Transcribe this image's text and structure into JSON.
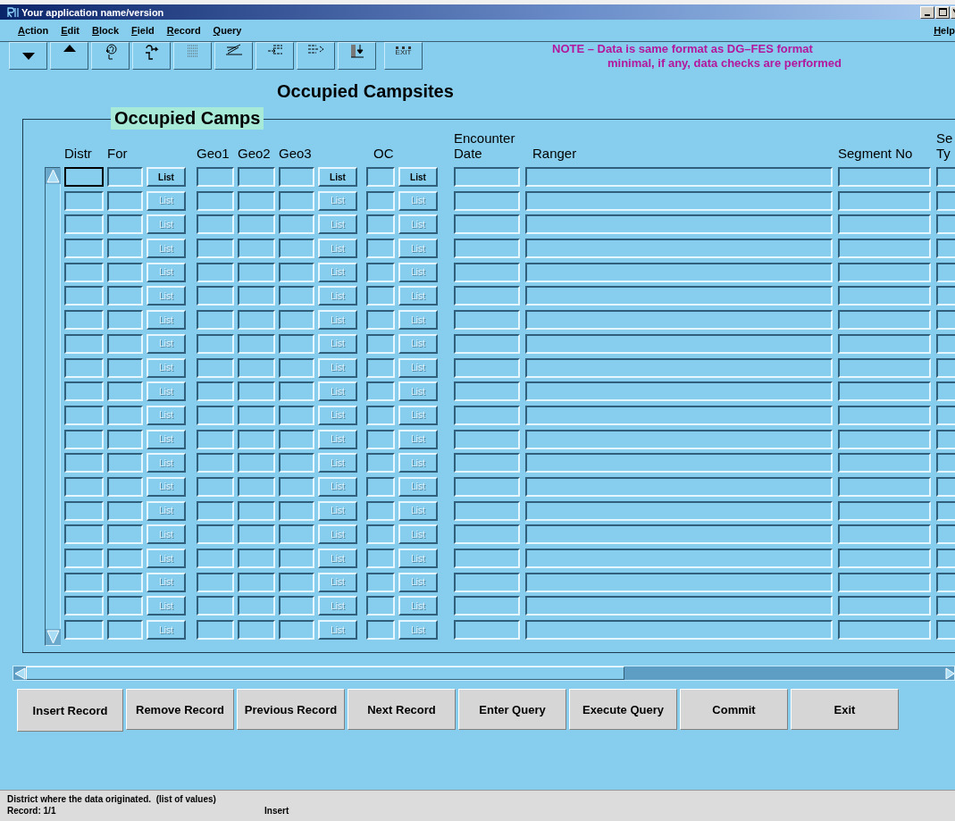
{
  "window": {
    "title": "Your application name/version"
  },
  "menu": {
    "items": [
      "Action",
      "Edit",
      "Block",
      "Field",
      "Record",
      "Query"
    ],
    "help": "Help"
  },
  "toolbar": {
    "buttons": [
      {
        "kind": "down"
      },
      {
        "kind": "up"
      },
      {
        "kind": "query"
      },
      {
        "kind": "execute"
      },
      {
        "kind": "list"
      },
      {
        "kind": "edit"
      },
      {
        "kind": "insert"
      },
      {
        "kind": "next"
      },
      {
        "kind": "save"
      },
      {
        "kind": "exit",
        "label": "EXIT"
      }
    ]
  },
  "note": [
    "NOTE – Data is same format as DG–FES format",
    "minimal, if any, data checks are performed"
  ],
  "heading": "Occupied Campsites",
  "frame": {
    "title": "Occupied Camps"
  },
  "table": {
    "columns": [
      "Distr",
      "For",
      "Geo1",
      "Geo2",
      "Geo3",
      "OC",
      "Encounter Date",
      "Ranger",
      "Segment No",
      "Se Ty"
    ],
    "rows": [
      {
        "focused": true,
        "disabled": false,
        "lists": [
          "List",
          "List",
          "List"
        ]
      },
      {
        "focused": false,
        "disabled": true,
        "lists": [
          "List",
          "List",
          "List"
        ]
      },
      {
        "focused": false,
        "disabled": true,
        "lists": [
          "List",
          "List",
          "List"
        ]
      },
      {
        "focused": false,
        "disabled": true,
        "lists": [
          "List",
          "List",
          "List"
        ]
      },
      {
        "focused": false,
        "disabled": true,
        "lists": [
          "List",
          "List",
          "List"
        ]
      },
      {
        "focused": false,
        "disabled": true,
        "lists": [
          "List",
          "List",
          "List"
        ]
      },
      {
        "focused": false,
        "disabled": true,
        "lists": [
          "List",
          "List",
          "List"
        ]
      },
      {
        "focused": false,
        "disabled": true,
        "lists": [
          "List",
          "List",
          "List"
        ]
      },
      {
        "focused": false,
        "disabled": true,
        "lists": [
          "List",
          "List",
          "List"
        ]
      },
      {
        "focused": false,
        "disabled": true,
        "lists": [
          "List",
          "List",
          "List"
        ]
      },
      {
        "focused": false,
        "disabled": true,
        "lists": [
          "List",
          "List",
          "List"
        ]
      },
      {
        "focused": false,
        "disabled": true,
        "lists": [
          "List",
          "List",
          "List"
        ]
      },
      {
        "focused": false,
        "disabled": true,
        "lists": [
          "List",
          "List",
          "List"
        ]
      },
      {
        "focused": false,
        "disabled": true,
        "lists": [
          "List",
          "List",
          "List"
        ]
      },
      {
        "focused": false,
        "disabled": true,
        "lists": [
          "List",
          "List",
          "List"
        ]
      },
      {
        "focused": false,
        "disabled": true,
        "lists": [
          "List",
          "List",
          "List"
        ]
      },
      {
        "focused": false,
        "disabled": true,
        "lists": [
          "List",
          "List",
          "List"
        ]
      },
      {
        "focused": false,
        "disabled": true,
        "lists": [
          "List",
          "List",
          "List"
        ]
      },
      {
        "focused": false,
        "disabled": true,
        "lists": [
          "List",
          "List",
          "List"
        ]
      },
      {
        "focused": false,
        "disabled": true,
        "lists": [
          "List",
          "List",
          "List"
        ]
      }
    ]
  },
  "buttons": [
    "Insert Record",
    "Remove Record",
    "Previous Record",
    "Next Record",
    "Enter Query",
    "Execute Query",
    "Commit",
    "Exit"
  ],
  "status_bar": {
    "hint": "District where the data originated.  (list of values)",
    "record": "Record: 1/1",
    "mode": "Insert"
  }
}
